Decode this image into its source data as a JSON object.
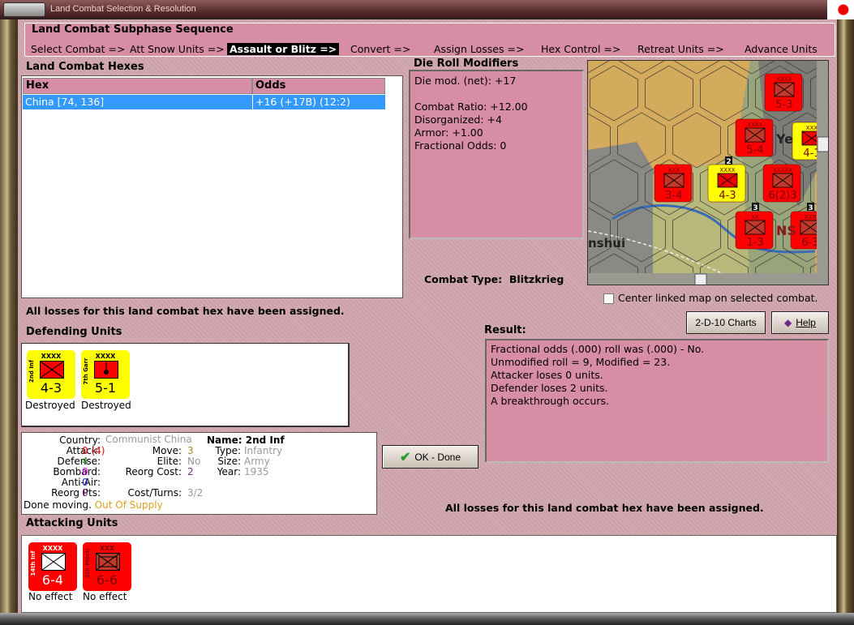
{
  "window": {
    "title": "Land Combat Selection & Resolution"
  },
  "subphase": {
    "title": "Land Combat Subphase Sequence",
    "steps": [
      "Select Combat =>",
      "Att Snow Units =>",
      "Assault or Blitz =>",
      "Convert =>",
      "Assign Losses =>",
      "Hex Control =>",
      "Retreat Units =>",
      "Advance Units"
    ],
    "active_step": "Assault or Blitz =>"
  },
  "hexes": {
    "label": "Land Combat Hexes",
    "columns": [
      "Hex",
      "Odds"
    ],
    "rows": [
      {
        "hex": "China [74, 136]",
        "odds": "+16 (+17B) (12:2)"
      }
    ]
  },
  "die_roll": {
    "label": "Die Roll Modifiers",
    "lines": [
      "Die mod. (net): +17",
      "",
      "Combat Ratio: +12.00",
      "Disorganized: +4",
      "Armor: +1.00",
      "Fractional Odds: 0"
    ]
  },
  "combat_type": {
    "label": "Combat Type:",
    "value": "Blitzkrieg"
  },
  "map": {
    "labels": [
      "Ye",
      "NS",
      "nshui"
    ],
    "counters": [
      {
        "size": "XXXX",
        "value": "5-3",
        "side": "red"
      },
      {
        "size": "XXXX",
        "value": "5-4",
        "side": "red"
      },
      {
        "size": "XXX",
        "value": "4-1",
        "side": "yellow"
      },
      {
        "size": "XXX",
        "value": "3-4",
        "side": "red"
      },
      {
        "size": "XXXX",
        "value": "4-3",
        "side": "yellow"
      },
      {
        "size": "XXXXX",
        "value": "6(2)3",
        "side": "red"
      },
      {
        "size": "XX",
        "value": "1-3",
        "side": "red"
      },
      {
        "size": "XXX",
        "value": "6-3",
        "side": "red"
      }
    ],
    "stack_badges": [
      "2",
      "3",
      "3"
    ]
  },
  "center_map": {
    "label": "Center linked map on selected combat.",
    "checked": false
  },
  "buttons": {
    "charts": "2-D-10 Charts",
    "help": "Help",
    "ok": "OK - Done"
  },
  "losses_msg": "All losses for this land combat hex have been assigned.",
  "result": {
    "label": "Result:",
    "lines": [
      "Fractional odds (.000) roll was (.000)  - No.",
      "Unmodified roll = 9, Modified = 23.",
      "Attacker loses 0 units.",
      "Defender loses 2 units.",
      "A breakthrough occurs."
    ]
  },
  "defending": {
    "label": "Defending Units",
    "units": [
      {
        "name": "2nd Inf",
        "size": "XXXX",
        "value": "4-3",
        "status": "Destroyed"
      },
      {
        "name": "7th Garr",
        "size": "XXXX",
        "value": "5-1",
        "status": "Destroyed"
      }
    ]
  },
  "attacking": {
    "label": "Attacking Units",
    "units": [
      {
        "name": "14th Inf",
        "size": "XXXX",
        "value": "6-4",
        "status": "No effect"
      },
      {
        "name": "5th Mech",
        "size": "XXX",
        "value": "6-6",
        "status": "No effect"
      }
    ]
  },
  "info": {
    "country_k": "Country:",
    "country": "Communist China",
    "attack_k": "Attack:",
    "attack": "0 (4)",
    "defense_k": "Defense:",
    "defense": "4",
    "bombard_k": "Bombard:",
    "bombard": "0",
    "antiair_k": "Anti-Air:",
    "antiair": "0",
    "reorgpts_k": "Reorg Pts:",
    "reorgpts": "0",
    "move_k": "Move:",
    "move": "3",
    "elite_k": "Elite:",
    "elite": "No",
    "reorgcost_k": "Reorg Cost:",
    "reorgcost": "2",
    "costturns_k": "Cost/Turns:",
    "costturns": "3/2",
    "name": "Name: 2nd Inf",
    "type_k": "Type:",
    "type": "Infantry",
    "size_k": "Size:",
    "size": "Army",
    "year_k": "Year:",
    "year": "1935",
    "status": "Done moving.",
    "supply": "Out Of Supply"
  },
  "colors": {
    "panel": "#d78da3",
    "selection": "#3399ff",
    "enemy_counter": "#ff0000",
    "own_counter": "#ffff00"
  }
}
